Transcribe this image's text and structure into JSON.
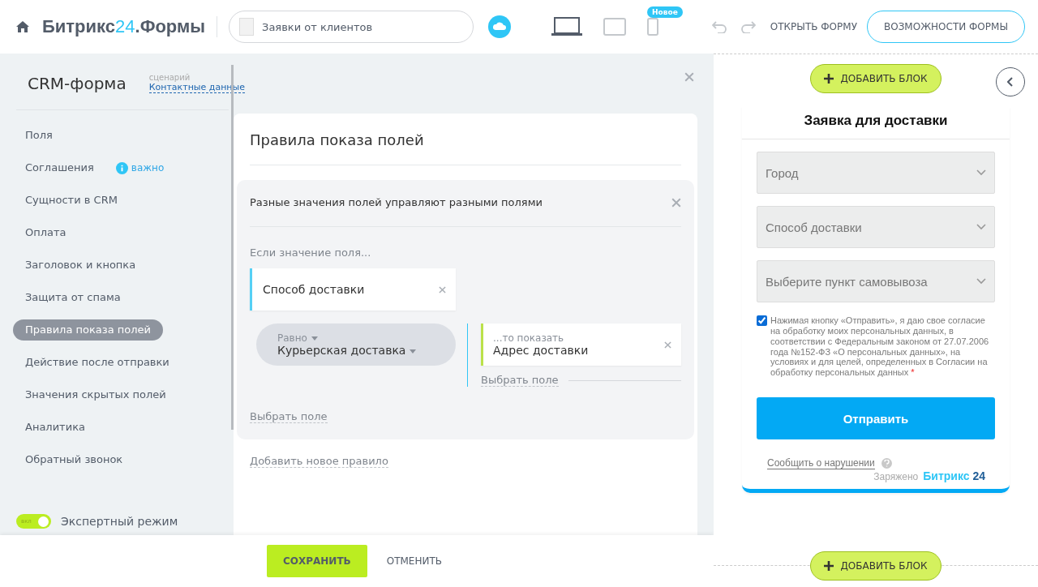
{
  "header": {
    "logo": {
      "name": "Битрикс",
      "number": "24",
      "suffix": ".Формы"
    },
    "form_name": "Заявки от клиентов",
    "devices": [
      {
        "kind": "desktop",
        "selected": true
      },
      {
        "kind": "tablet",
        "selected": false
      },
      {
        "kind": "mobile",
        "selected": false,
        "badge": "Новое"
      }
    ],
    "open_form": "ОТКРЫТЬ ФОРМУ",
    "features": "ВОЗМОЖНОСТИ ФОРМЫ"
  },
  "sidebar": {
    "title": "CRM-форма",
    "scenario_label": "сценарий",
    "scenario": "Контактные данные",
    "items": [
      {
        "label": "Поля",
        "selected": false
      },
      {
        "label": "Соглашения",
        "selected": false,
        "note": "важно"
      },
      {
        "label": "Сущности в CRM",
        "selected": false
      },
      {
        "label": "Оплата",
        "selected": false
      },
      {
        "label": "Заголовок и кнопка",
        "selected": false
      },
      {
        "label": "Защита от спама",
        "selected": false
      },
      {
        "label": "Правила показа полей",
        "selected": true
      },
      {
        "label": "Действие после отправки",
        "selected": false
      },
      {
        "label": "Значения скрытых полей",
        "selected": false
      },
      {
        "label": "Аналитика",
        "selected": false
      },
      {
        "label": "Обратный звонок",
        "selected": false
      }
    ],
    "expert": {
      "switch_text": "вкл",
      "label": "Экспертный режим",
      "on": true
    }
  },
  "panel": {
    "title": "Правила показа полей",
    "rule": {
      "title": "Разные значения полей управляют разными полями",
      "if_label": "Если значение поля...",
      "field": "Способ доставки",
      "operator": "Равно",
      "value": "Курьерская доставка",
      "then_label": "...то показать",
      "target": "Адрес доставки",
      "choose_target": "Выбрать поле",
      "choose_field": "Выбрать поле"
    },
    "add_rule": "Добавить новое правило"
  },
  "footer": {
    "save": "СОХРАНИТЬ",
    "cancel": "ОТМЕНИТЬ"
  },
  "preview": {
    "add_block_top": "ДОБАВИТЬ БЛОК",
    "add_block_bottom": "ДОБАВИТЬ БЛОК",
    "form_title": "Заявка для доставки",
    "selects": [
      "Город",
      "Способ доставки",
      "Выберите пункт самовывоза"
    ],
    "consent": {
      "checked": true,
      "text": "Нажимая кнопку «Отправить», я даю свое согласие на обработку моих персональных данных, в соответствии с Федеральным законом от 27.07.2006 года №152-ФЗ «О персональных данных», на условиях и для целей, определенных в Согласии на обработку персональных данных",
      "required": "*"
    },
    "submit": "Отправить",
    "report": "Сообщить о нарушении",
    "powered": "Заряжено",
    "brand": {
      "name": "Битрикс",
      "number": "24"
    }
  }
}
